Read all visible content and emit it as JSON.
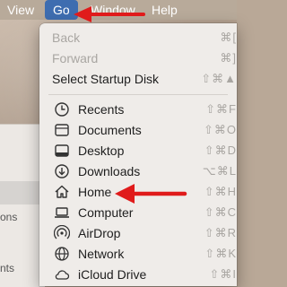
{
  "menubar": {
    "view": "View",
    "go": "Go",
    "window": "Window",
    "help": "Help"
  },
  "behind": {
    "frag1": "ons",
    "frag2": "nts"
  },
  "menu": {
    "back": {
      "label": "Back",
      "shortcut": "⌘["
    },
    "forward": {
      "label": "Forward",
      "shortcut": "⌘]"
    },
    "startup": {
      "label": "Select Startup Disk",
      "shortcut": "⇧⌘▲"
    },
    "items": [
      {
        "label": "Recents",
        "shortcut": "⇧⌘F",
        "icon": "clock-icon"
      },
      {
        "label": "Documents",
        "shortcut": "⇧⌘O",
        "icon": "document-icon"
      },
      {
        "label": "Desktop",
        "shortcut": "⇧⌘D",
        "icon": "desktop-icon"
      },
      {
        "label": "Downloads",
        "shortcut": "⌥⌘L",
        "icon": "download-icon"
      },
      {
        "label": "Home",
        "shortcut": "⇧⌘H",
        "icon": "home-icon"
      },
      {
        "label": "Computer",
        "shortcut": "⇧⌘C",
        "icon": "laptop-icon"
      },
      {
        "label": "AirDrop",
        "shortcut": "⇧⌘R",
        "icon": "airdrop-icon"
      },
      {
        "label": "Network",
        "shortcut": "⇧⌘K",
        "icon": "network-icon"
      },
      {
        "label": "iCloud Drive",
        "shortcut": "⇧⌘I",
        "icon": "cloud-icon"
      }
    ]
  },
  "colors": {
    "menu_highlight": "#3e6db0",
    "arrow": "#e01b1b"
  }
}
